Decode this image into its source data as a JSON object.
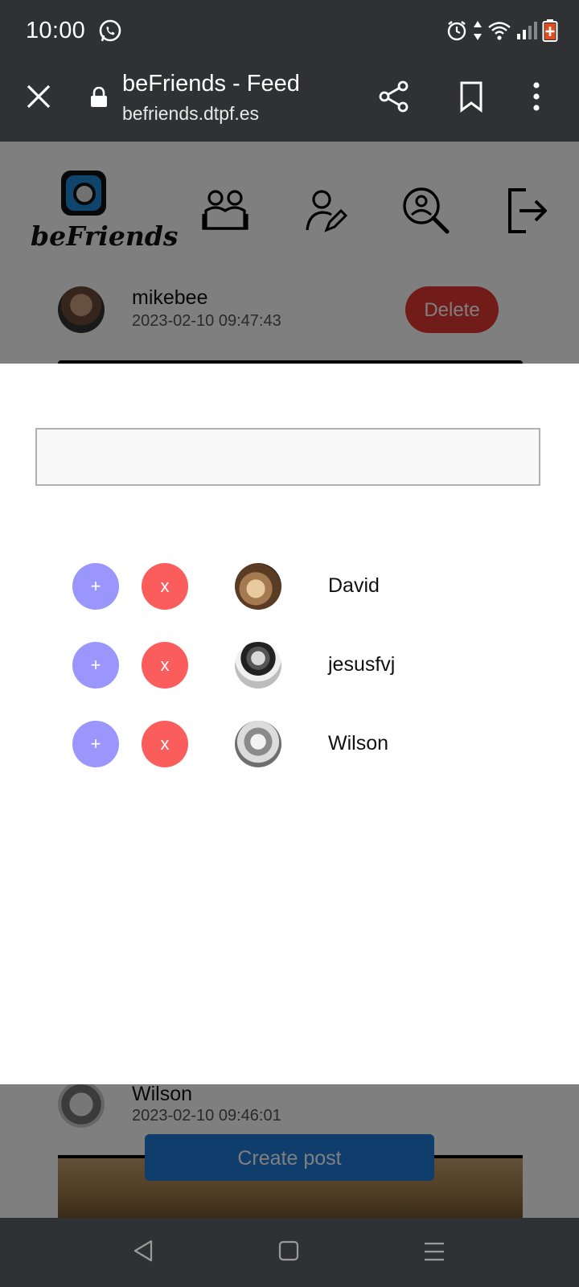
{
  "status_bar": {
    "time": "10:00",
    "icons": [
      "whatsapp-icon",
      "alarm-icon",
      "data-arrows-icon",
      "wifi-icon",
      "signal-icon",
      "battery-icon"
    ]
  },
  "browser": {
    "title": "beFriends - Feed",
    "url": "befriends.dtpf.es",
    "icons": [
      "close-icon",
      "lock-icon",
      "share-icon",
      "bookmark-icon",
      "more-vert-icon"
    ]
  },
  "app_nav": {
    "logo_text": "beFriends",
    "icons": [
      "friends-icon",
      "edit-profile-icon",
      "search-user-icon",
      "logout-icon"
    ]
  },
  "post1": {
    "username": "mikebee",
    "date": "2023-02-10 09:47:43",
    "delete_label": "Delete"
  },
  "modal": {
    "search": {
      "value": "",
      "placeholder": ""
    },
    "requests": [
      {
        "name": "David",
        "accept_label": "+",
        "reject_label": "x"
      },
      {
        "name": "jesusfvj",
        "accept_label": "+",
        "reject_label": "x"
      },
      {
        "name": "Wilson",
        "accept_label": "+",
        "reject_label": "x"
      }
    ]
  },
  "post2": {
    "username": "Wilson",
    "date": "2023-02-10 09:46:01"
  },
  "create_post_label": "Create post",
  "colors": {
    "accept": "#9b96fb",
    "reject": "#fb5c5c",
    "delete": "#e53935",
    "create_post": "#1e7ad9",
    "system_bar": "#303134"
  }
}
